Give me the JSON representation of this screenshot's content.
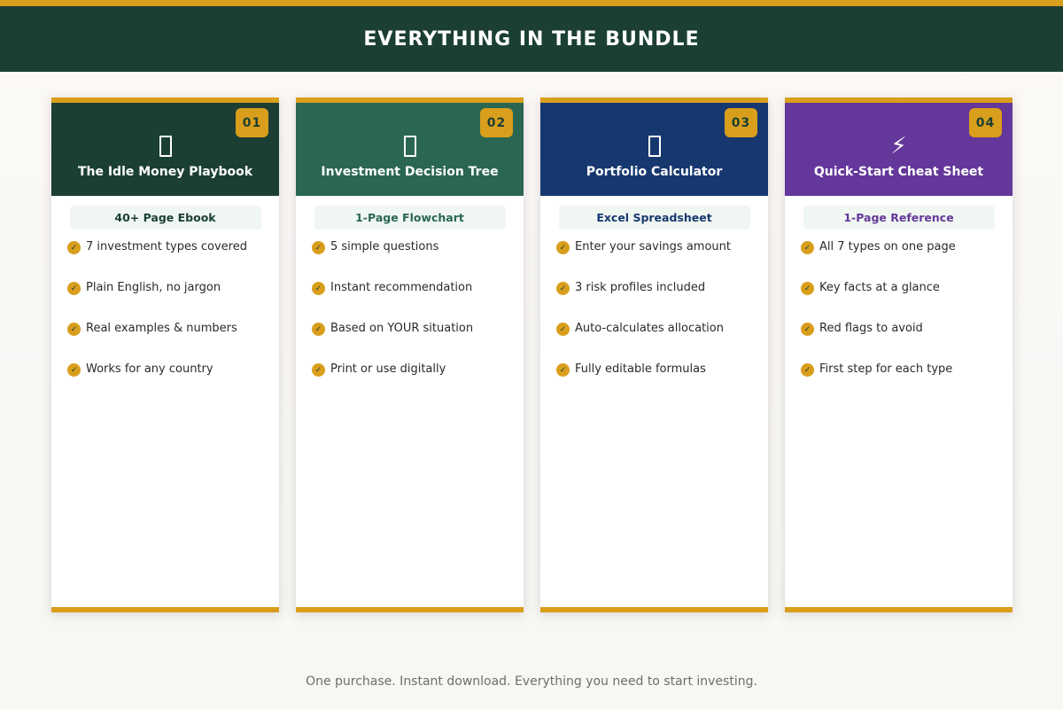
{
  "header": {
    "title": "EVERYTHING IN THE BUNDLE"
  },
  "colors": {
    "gold": "#d99e1c",
    "header_bg": "#1b3f33"
  },
  "cards": [
    {
      "number": "01",
      "icon": "book-icon",
      "title": "The Idle Money Playbook",
      "tag": "40+ Page Ebook",
      "color": "#1b3f33",
      "features": [
        "7 investment types covered",
        "Plain English, no jargon",
        "Real examples & numbers",
        "Works for any country"
      ]
    },
    {
      "number": "02",
      "icon": "flowchart-icon",
      "title": "Investment Decision Tree",
      "tag": "1-Page Flowchart",
      "color": "#2a6652",
      "features": [
        "5 simple questions",
        "Instant recommendation",
        "Based on YOUR situation",
        "Print or use digitally"
      ]
    },
    {
      "number": "03",
      "icon": "calculator-icon",
      "title": "Portfolio Calculator",
      "tag": "Excel Spreadsheet",
      "color": "#17386f",
      "features": [
        "Enter your savings amount",
        "3 risk profiles included",
        "Auto-calculates allocation",
        "Fully editable formulas"
      ]
    },
    {
      "number": "04",
      "icon": "lightning-icon",
      "title": "Quick-Start Cheat Sheet",
      "tag": "1-Page Reference",
      "color": "#64379a",
      "features": [
        "All 7 types on one page",
        "Key facts at a glance",
        "Red flags to avoid",
        "First step for each type"
      ]
    }
  ],
  "footer": {
    "note": "One purchase. Instant download. Everything you need to start investing."
  }
}
